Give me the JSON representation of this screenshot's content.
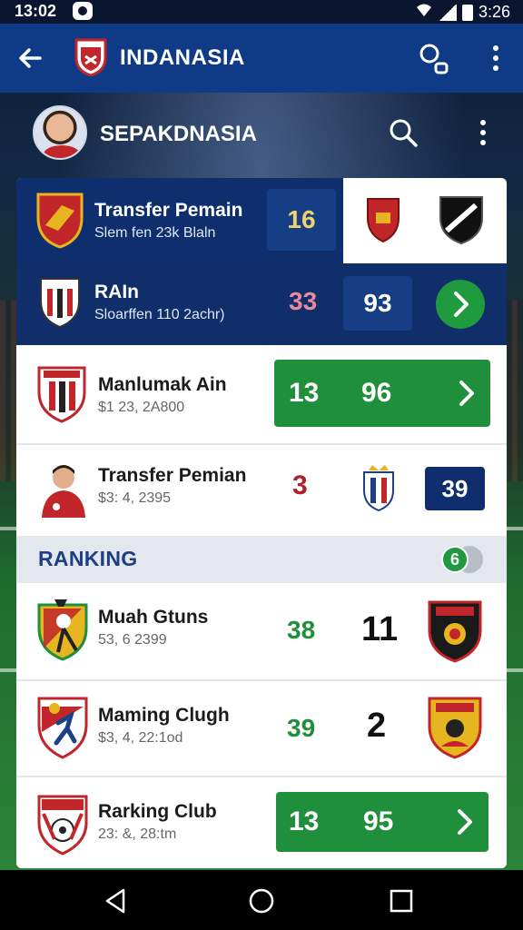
{
  "status_bar": {
    "time": "13:02",
    "battery": "3:26"
  },
  "app_bar": {
    "title": "INDANASIA"
  },
  "profile": {
    "name": "SEPAKDNASIA"
  },
  "rows": [
    {
      "title": "Transfer Pemain",
      "subtitle": "Slem fen 23k Blaln",
      "badge_value": "16"
    },
    {
      "title": "RAIn",
      "subtitle": "Sloarffen 110 2achr)",
      "stat": "33",
      "box_value": "93"
    },
    {
      "title": "Manlumak Ain",
      "subtitle": "$1 23, 2A800",
      "bar_left": "13",
      "bar_right": "96"
    },
    {
      "title": "Transfer Pemian",
      "subtitle": "$3: 4, 2395",
      "stat": "3",
      "box_value": "39"
    }
  ],
  "ranking": {
    "label": "RANKING",
    "badge": "6",
    "items": [
      {
        "title": "Muah Gtuns",
        "subtitle": "53, 6 2399",
        "stat": "38",
        "value": "11"
      },
      {
        "title": "Maming Clugh",
        "subtitle": "$3, 4, 22:1od",
        "stat": "39",
        "value": "2"
      },
      {
        "title": "Rarking Club",
        "subtitle": "23: &, 28:tm",
        "bar_left": "13",
        "bar_right": "95"
      }
    ]
  },
  "colors": {
    "primary": "#0e3a86",
    "navy": "#0f2e6e",
    "green": "#1f8f3c",
    "red": "#c0262a"
  },
  "icons": [
    "back-arrow-icon",
    "search-icon",
    "more-vert-icon",
    "chevron-right-icon",
    "nav-back-icon",
    "nav-home-icon",
    "nav-recents-icon"
  ]
}
